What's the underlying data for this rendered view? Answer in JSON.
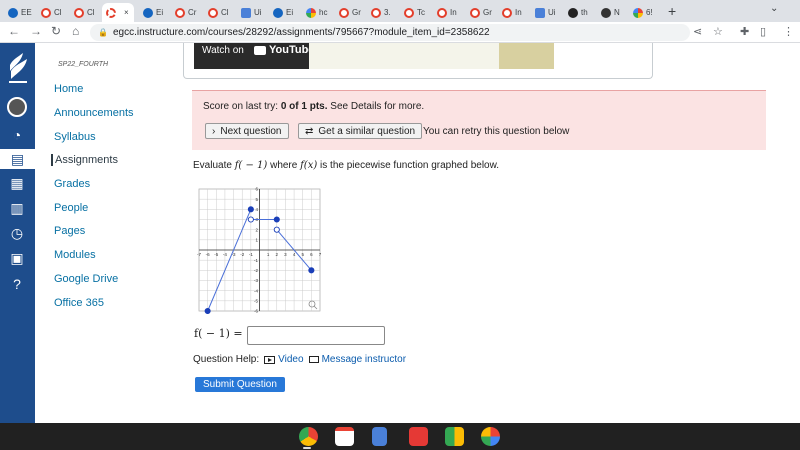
{
  "browser": {
    "tabs": [
      {
        "label": "EE",
        "icon": "blue"
      },
      {
        "label": "Cl",
        "icon": "canvas"
      },
      {
        "label": "Cl",
        "icon": "canvas"
      },
      {
        "label": "",
        "icon": "canvas-dash",
        "active": true
      },
      {
        "label": "Ei",
        "icon": "blue"
      },
      {
        "label": "Cr",
        "icon": "canvas"
      },
      {
        "label": "Cl",
        "icon": "canvas"
      },
      {
        "label": "Ui",
        "icon": "doc"
      },
      {
        "label": "Ei",
        "icon": "blue"
      },
      {
        "label": "hc",
        "icon": "google"
      },
      {
        "label": "Gr",
        "icon": "canvas"
      },
      {
        "label": "3.",
        "icon": "canvas"
      },
      {
        "label": "Tc",
        "icon": "canvas"
      },
      {
        "label": "In",
        "icon": "canvas"
      },
      {
        "label": "Gr",
        "icon": "canvas"
      },
      {
        "label": "In",
        "icon": "canvas"
      },
      {
        "label": "Ui",
        "icon": "doc"
      },
      {
        "label": "th",
        "icon": "gh"
      },
      {
        "label": "N",
        "icon": "dark"
      },
      {
        "label": "6!",
        "icon": "google"
      }
    ],
    "active_tab_close": "×",
    "new_tab": "+",
    "tab_menu": "⌄",
    "url": "egcc.instructure.com/courses/28292/assignments/795667?module_item_id=2358622"
  },
  "course": {
    "code": "SP22_FOURTH",
    "nav": [
      {
        "label": "Home",
        "active": false
      },
      {
        "label": "Announcements",
        "active": false
      },
      {
        "label": "Syllabus",
        "active": false
      },
      {
        "label": "Assignments",
        "active": true
      },
      {
        "label": "Grades",
        "active": false
      },
      {
        "label": "People",
        "active": false
      },
      {
        "label": "Pages",
        "active": false
      },
      {
        "label": "Modules",
        "active": false
      },
      {
        "label": "Google Drive",
        "active": false
      },
      {
        "label": "Office 365",
        "active": false
      }
    ]
  },
  "video": {
    "watch_on": "Watch on",
    "platform": "YouTube"
  },
  "score": {
    "prefix": "Score on last try: ",
    "value": "0 of 1 pts.",
    "suffix": " See Details for more.",
    "next_button": "Next question",
    "similar_button": "Get a similar question",
    "retry_text": "You can retry this question below"
  },
  "question": {
    "before": "Evaluate ",
    "expr": "f( − 1)",
    "middle": " where ",
    "func": "f(x)",
    "after": " is the piecewise function graphed below."
  },
  "graph": {
    "x_ticks": [
      "-7",
      "-6",
      "-5",
      "-4",
      "-3",
      "-2",
      "-1",
      "1",
      "2",
      "3",
      "4",
      "5",
      "6",
      "7"
    ],
    "y_ticks": [
      "6",
      "5",
      "4",
      "3",
      "2",
      "1",
      "-1",
      "-2",
      "-3",
      "-4",
      "-5",
      "-6"
    ],
    "xlim": [
      -7,
      7
    ],
    "ylim": [
      -6,
      6
    ],
    "segments": [
      {
        "from": [
          -6,
          -6
        ],
        "to": [
          -1,
          4
        ],
        "from_closed": true,
        "to_closed": true
      },
      {
        "from": [
          -1,
          3
        ],
        "to": [
          2,
          3
        ],
        "from_closed": false,
        "to_closed": true
      },
      {
        "from": [
          2,
          2
        ],
        "to": [
          6,
          -2
        ],
        "from_closed": false,
        "to_closed": true
      }
    ],
    "line_color": "#4a6fd8",
    "point_color": "#1a3fb8"
  },
  "answer": {
    "label": "f( − 1) =",
    "value": "",
    "placeholder": ""
  },
  "help": {
    "label": "Question Help:",
    "video": "Video",
    "message": "Message instructor"
  },
  "submit_label": "Submit Question",
  "colors": {
    "rail": "#1e4d8c",
    "link": "#0770a3",
    "submit": "#2878d8",
    "score_bg": "#fbe3e3"
  }
}
